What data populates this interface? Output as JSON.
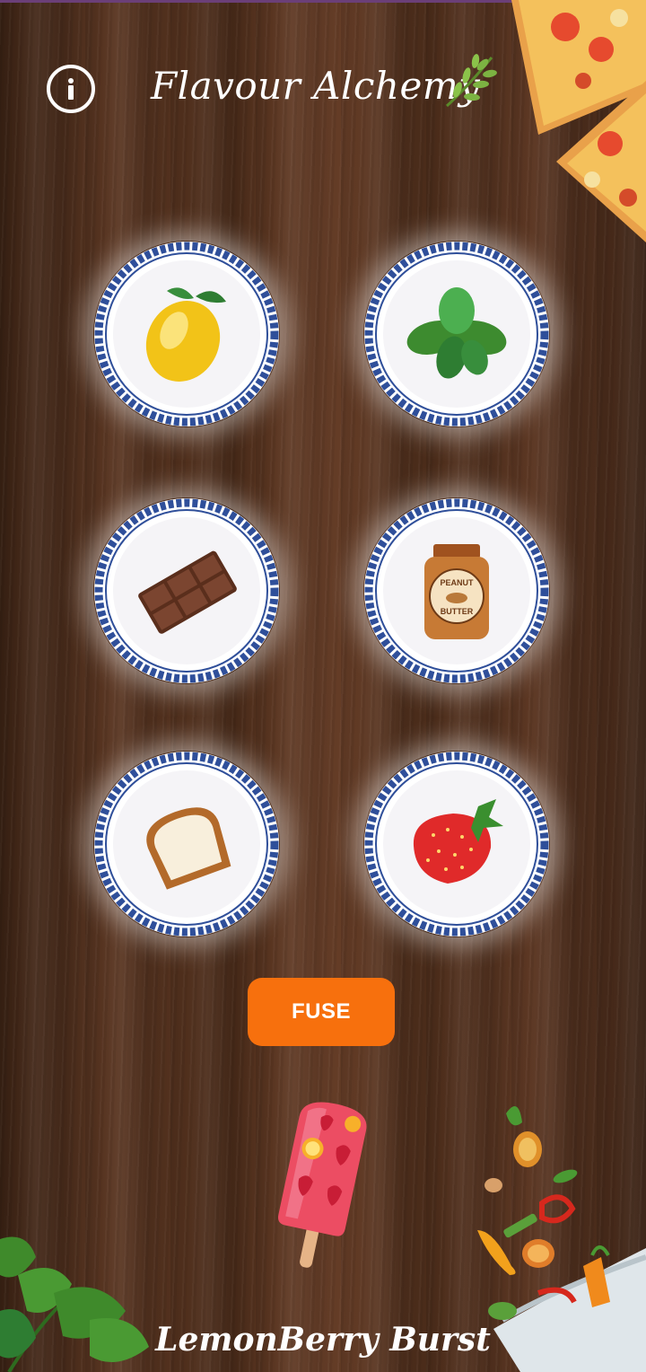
{
  "app": {
    "title": "Flavour Alchemy",
    "title_icon": "herb-sprig-icon"
  },
  "header": {
    "info_icon": "info-icon"
  },
  "ingredients": [
    {
      "name": "lemon",
      "icon": "lemon-icon"
    },
    {
      "name": "basil",
      "icon": "basil-icon"
    },
    {
      "name": "chocolate",
      "icon": "chocolate-bar-icon"
    },
    {
      "name": "peanut butter",
      "icon": "peanut-butter-jar-icon",
      "jar_label_top": "PEANUT",
      "jar_label_bottom": "BUTTER"
    },
    {
      "name": "bread",
      "icon": "bread-slice-icon"
    },
    {
      "name": "strawberry",
      "icon": "strawberry-icon"
    }
  ],
  "fuse_button": {
    "label": "FUSE"
  },
  "result": {
    "name": "LemonBerry Burst",
    "image": "popsicle-image"
  },
  "colors": {
    "accent": "#f7700d",
    "plate_rim": "#2f4f9a",
    "wood": "#5a3622"
  }
}
